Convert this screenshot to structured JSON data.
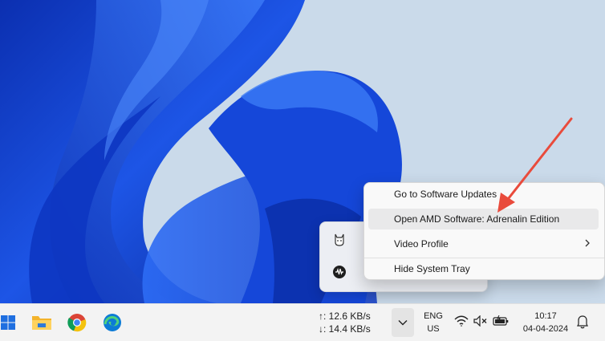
{
  "context_menu": {
    "items": [
      {
        "label": "Go to Software Updates",
        "highlighted": false,
        "submenu": false
      },
      {
        "label": "Open AMD Software: Adrenalin Edition",
        "highlighted": true,
        "submenu": false
      },
      {
        "label": "Video Profile",
        "highlighted": false,
        "submenu": true
      },
      {
        "label": "Hide System Tray",
        "highlighted": false,
        "submenu": false
      }
    ]
  },
  "tray_flyout": {
    "icons": [
      "cat-app-icon",
      "audio-waveform-icon"
    ]
  },
  "taskbar": {
    "pinned": [
      "windows-start-icon",
      "file-explorer-icon",
      "chrome-icon",
      "edge-icon"
    ],
    "net_speed": {
      "up": "↑: 12.6 KB/s",
      "down": "↓: 14.4 KB/s"
    },
    "language": {
      "line1": "ENG",
      "line2": "US"
    },
    "clock": {
      "time": "10:17",
      "date": "04-04-2024"
    },
    "system_icons": [
      "wifi-icon",
      "speaker-muted-icon",
      "battery-icon",
      "notification-bell-icon"
    ]
  },
  "colors": {
    "annotation_arrow": "#e94b3c",
    "wallpaper_blue": "#1a47d8",
    "wallpaper_bg": "#c9d9ea"
  }
}
